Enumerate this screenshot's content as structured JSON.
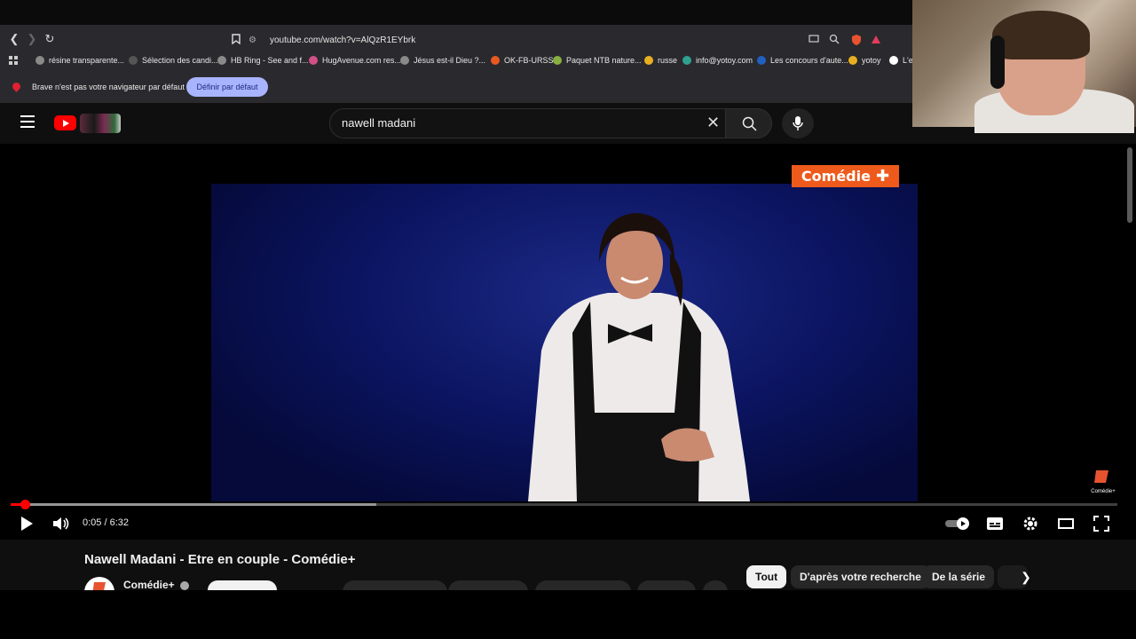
{
  "browser": {
    "url": "youtube.com/watch?v=AlQzR1EYbrk",
    "bookmarks": [
      {
        "label": "résine transparente...",
        "color": "#8a8a8a"
      },
      {
        "label": "Sélection des candi...",
        "color": "#555555"
      },
      {
        "label": "HB Ring - See and f...",
        "color": "#8a8a8a"
      },
      {
        "label": "HugAvenue.com res...",
        "color": "#d05088"
      },
      {
        "label": "Jésus est-il Dieu ?...",
        "color": "#8a8a8a"
      },
      {
        "label": "OK-FB-URSS",
        "color": "#e85a20"
      },
      {
        "label": "Paquet NTB nature...",
        "color": "#88b040"
      },
      {
        "label": "russe",
        "color": "#e8b020"
      },
      {
        "label": "info@yotoy.com",
        "color": "#30a090"
      },
      {
        "label": "Les concours d'aute...",
        "color": "#2060c0"
      },
      {
        "label": "yotoy",
        "color": "#e8b020"
      },
      {
        "label": "L'es",
        "color": "#ffffff"
      }
    ],
    "infobar_text": "Brave n'est pas votre navigateur par défaut",
    "infobar_button": "Définir par défaut"
  },
  "youtube": {
    "search_value": "nawell madani"
  },
  "player": {
    "watermark": "Comédie",
    "watermark_small": "Comédie+",
    "time": "0:05 / 6:32",
    "progress_fraction": 0.013,
    "buffered_fraction": 0.33
  },
  "video": {
    "title": "Nawell Madani - Etre en couple - Comédie+",
    "channel": "Comédie+"
  },
  "chips": [
    "Tout",
    "D'après votre recherche",
    "De la série"
  ]
}
